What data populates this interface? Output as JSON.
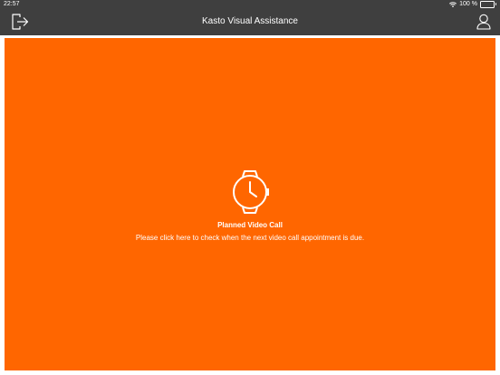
{
  "status_bar": {
    "time": "22:57",
    "battery_text": "100 %"
  },
  "header": {
    "title": "Kasto Visual Assistance",
    "logout_icon": "logout-icon",
    "user_icon": "user-icon"
  },
  "main": {
    "background_color": "#ff6600",
    "icon": "watch-clock-icon",
    "title": "Planned Video Call",
    "description": "Please click here to check when the next video call appointment is due."
  },
  "colors": {
    "bar": "#3f3f3f",
    "accent": "#ff6600",
    "text_light": "#ffffff"
  }
}
